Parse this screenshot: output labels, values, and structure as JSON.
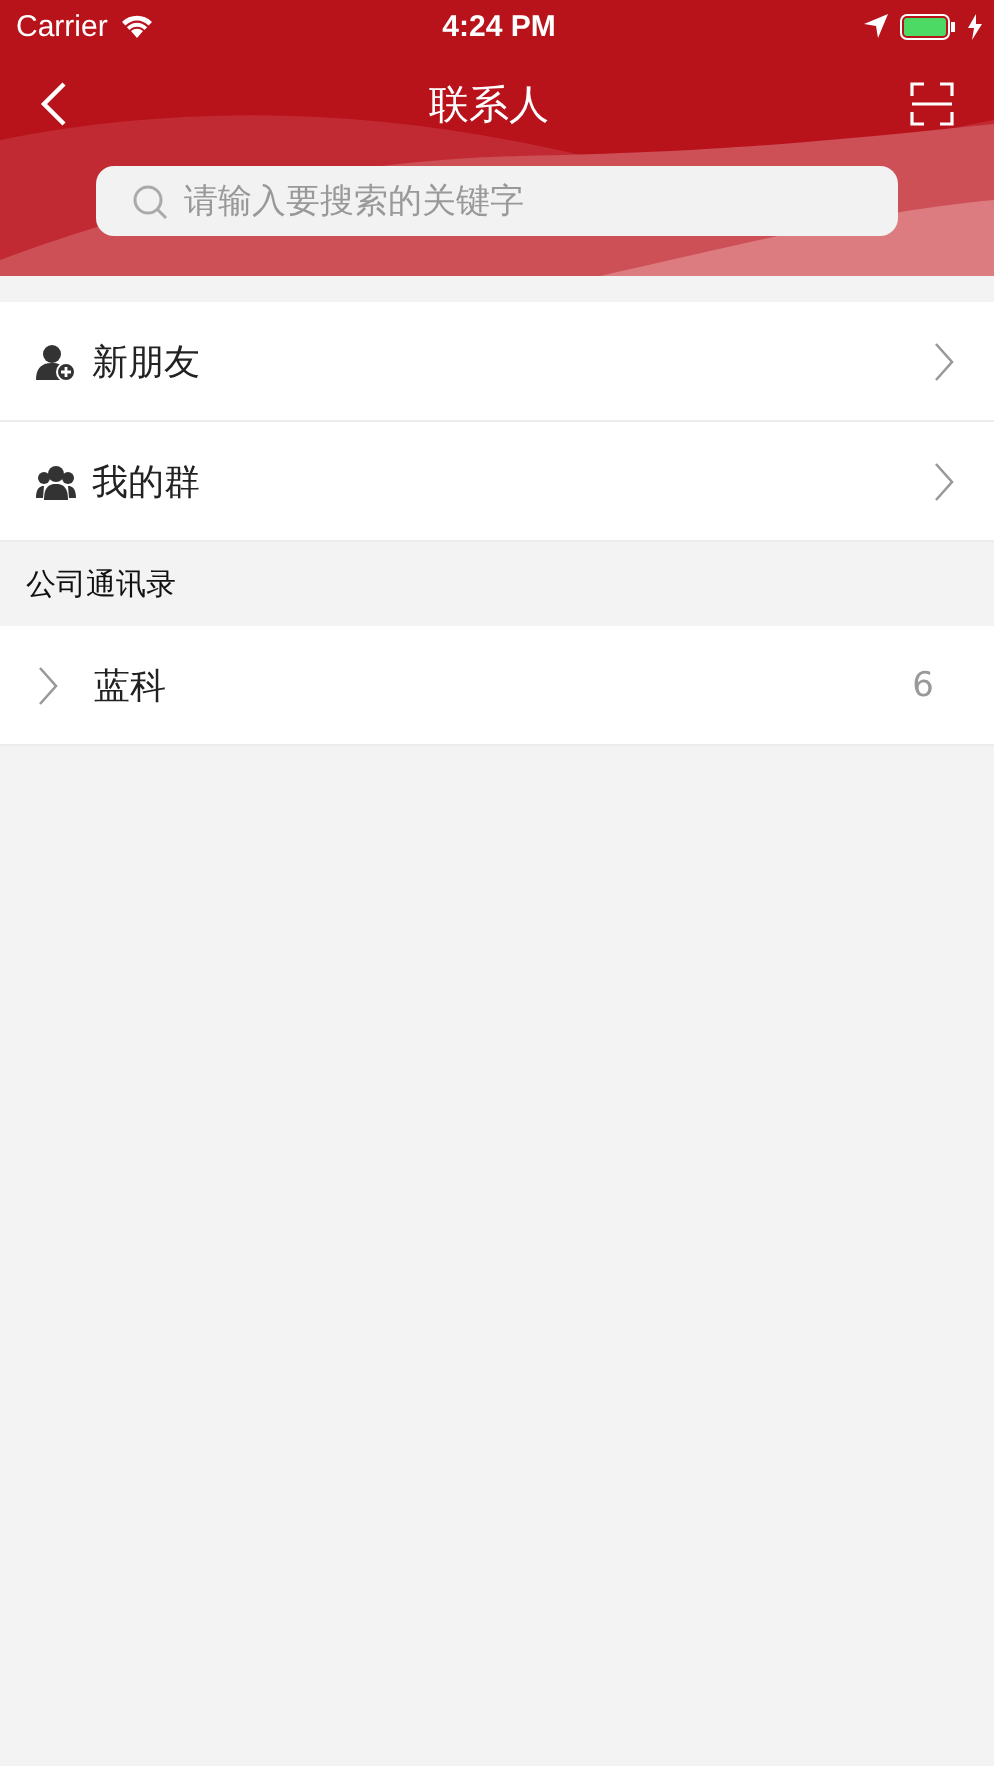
{
  "status_bar": {
    "carrier": "Carrier",
    "time": "4:24 PM"
  },
  "nav": {
    "title": "联系人"
  },
  "search": {
    "placeholder": "请输入要搜索的关键字"
  },
  "entries": [
    {
      "kind": "add-friend",
      "label": "新朋友"
    },
    {
      "kind": "group",
      "label": "我的群"
    }
  ],
  "section": {
    "title": "公司通讯录",
    "departments": [
      {
        "name": "蓝科",
        "count": "6",
        "expanded": false
      }
    ]
  }
}
